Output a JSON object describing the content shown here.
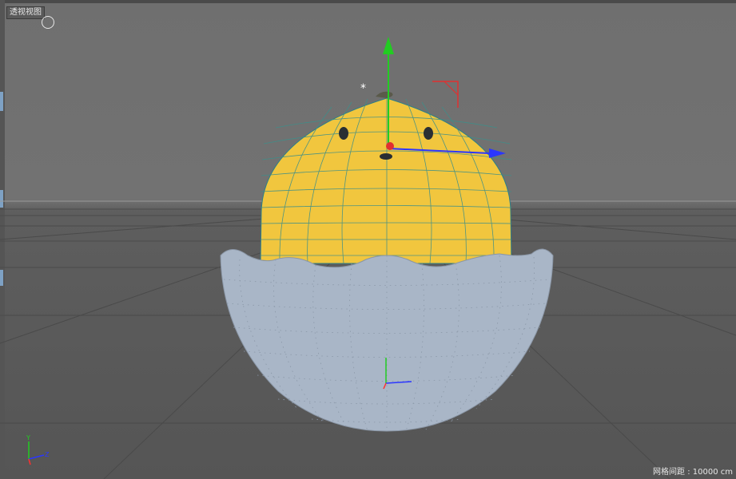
{
  "viewport": {
    "label": "透视视图",
    "grid_spacing": "网格间距 : 10000 cm"
  },
  "axes_gizmo": {
    "y_label": "Y",
    "z_label": "Z"
  },
  "scene": {
    "head_color": "#f1c63e",
    "eggshell_color": "#a9b6c7",
    "axis_colors": {
      "x": "#2b36ff",
      "y": "#22cc22",
      "z": "#ff3030"
    }
  }
}
